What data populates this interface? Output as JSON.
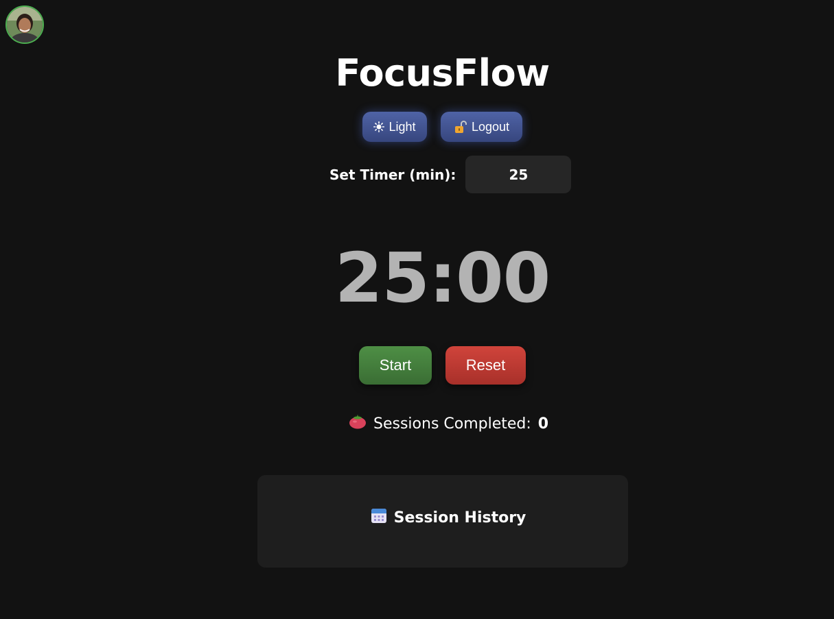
{
  "app": {
    "title": "FocusFlow"
  },
  "avatar": {
    "icon": "user-avatar",
    "border_color": "#4caf50"
  },
  "header_buttons": {
    "theme_icon": "sun-icon",
    "theme_label": "Light",
    "logout_icon": "unlocked-padlock-icon",
    "logout_label": "Logout"
  },
  "timer_setting": {
    "label": "Set Timer (min):",
    "value": "25"
  },
  "countdown": {
    "display": "25:00"
  },
  "controls": {
    "start_label": "Start",
    "reset_label": "Reset"
  },
  "sessions": {
    "icon": "tomato-icon",
    "label": "Sessions Completed:",
    "count": "0"
  },
  "history": {
    "icon": "calendar-icon",
    "title": "Session History"
  },
  "colors": {
    "background": "#121212",
    "card": "#1e1e1e",
    "accent_blue": "#4f63a6",
    "start_green": "#4e8f45",
    "reset_red": "#d0443b",
    "countdown_gray": "#b3b3b3"
  }
}
